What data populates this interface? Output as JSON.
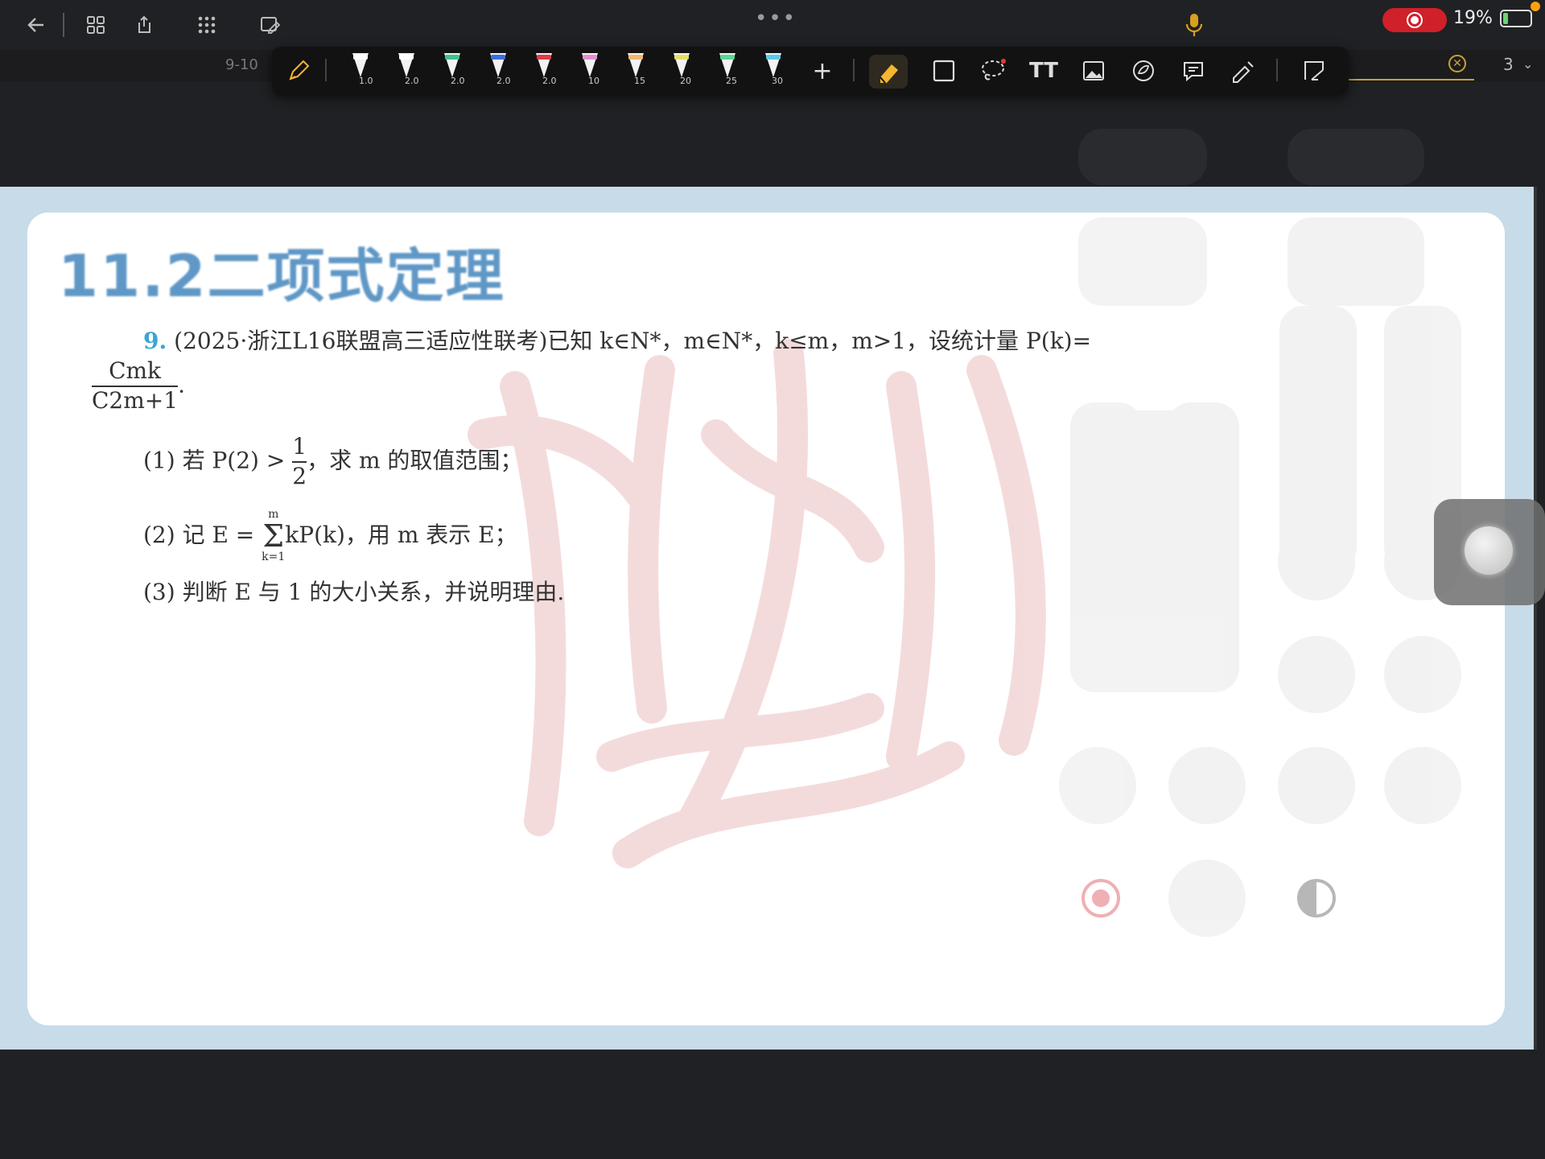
{
  "status_bar": {
    "dots": "•••",
    "battery_percent": "19%",
    "battery_level": 0.19
  },
  "header": {
    "tab_label": "9-10",
    "page_number": "3"
  },
  "toolbar": {
    "pens": [
      {
        "label": "1.0",
        "color": "#ffffff"
      },
      {
        "label": "2.0",
        "color": "#ffffff"
      },
      {
        "label": "2.0",
        "color": "#3fc28a"
      },
      {
        "label": "2.0",
        "color": "#3b6fd8"
      },
      {
        "label": "2.0",
        "color": "#e03a4a"
      },
      {
        "label": "10",
        "color": "#e48fd0"
      },
      {
        "label": "15",
        "color": "#f0b86a"
      },
      {
        "label": "20",
        "color": "#e8e060"
      },
      {
        "label": "25",
        "color": "#58d890"
      },
      {
        "label": "30",
        "color": "#5cc8e8"
      }
    ],
    "add_label": "+",
    "text_tool_label": "TT",
    "accent_color": "#f5b731"
  },
  "document": {
    "section_title": "11.2二项式定理",
    "question": {
      "number": "9.",
      "line1": "(2025·浙江L16联盟高三适应性联考)已知 k∈N*，m∈N*，k≤m，m>1，设统计量 P(k)=",
      "frac_num": "Cmk",
      "frac_den": "C2m+1",
      "frac_tail": ".",
      "part1_pre": "(1) 若 P(2) >",
      "part1_num": "1",
      "part1_den": "2",
      "part1_post": "，求 m 的取值范围；",
      "part2_pre": "(2) 记 E =",
      "part2_sum": "Σ",
      "part2_upper": "m",
      "part2_lower": "k=1",
      "part2_post": "kP(k)，用 m 表示 E；",
      "part3": "(3) 判断 E 与 1 的大小关系，并说明理由."
    }
  }
}
